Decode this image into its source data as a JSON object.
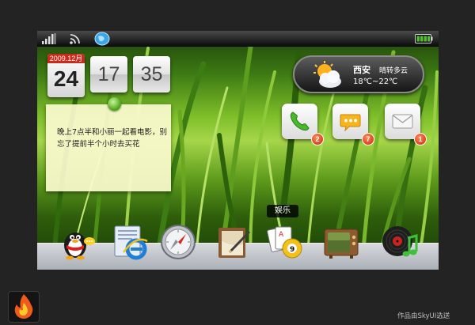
{
  "status_bar": {
    "signal_icon": "signal-bars-icon",
    "wifi_icon": "wifi-icon",
    "globe_icon": "globe-icon",
    "battery_icon": "battery-icon"
  },
  "date": {
    "month_label": "2009.12月",
    "day": "24",
    "hour": "17",
    "minute": "35"
  },
  "note": {
    "text": "晚上7点半和小丽一起看电影，别忘了提前半个小时去买花"
  },
  "weather": {
    "city": "西安",
    "condition": "晴转多云",
    "temperature": "18℃~22℃",
    "icon": "partly-cloudy-icon"
  },
  "apps": [
    {
      "name": "phone",
      "icon": "phone-icon",
      "badge": "2"
    },
    {
      "name": "messages",
      "icon": "chat-bubble-icon",
      "badge": "7"
    },
    {
      "name": "mail",
      "icon": "envelope-icon",
      "badge": "1"
    }
  ],
  "dock": {
    "tooltip": "娱乐",
    "items": [
      {
        "icon": "qq-penguin-icon"
      },
      {
        "icon": "internet-explorer-icon"
      },
      {
        "icon": "compass-icon"
      },
      {
        "icon": "notepad-icon"
      },
      {
        "icon": "cards-billiards-icon"
      },
      {
        "icon": "television-icon"
      },
      {
        "icon": "music-record-icon"
      }
    ]
  },
  "footer": {
    "credit": "作品由SkyUI选送",
    "logo_icon": "fire-logo-icon"
  },
  "colors": {
    "accent_red": "#c92a1c",
    "badge": "#d22208",
    "background": "#232323"
  }
}
